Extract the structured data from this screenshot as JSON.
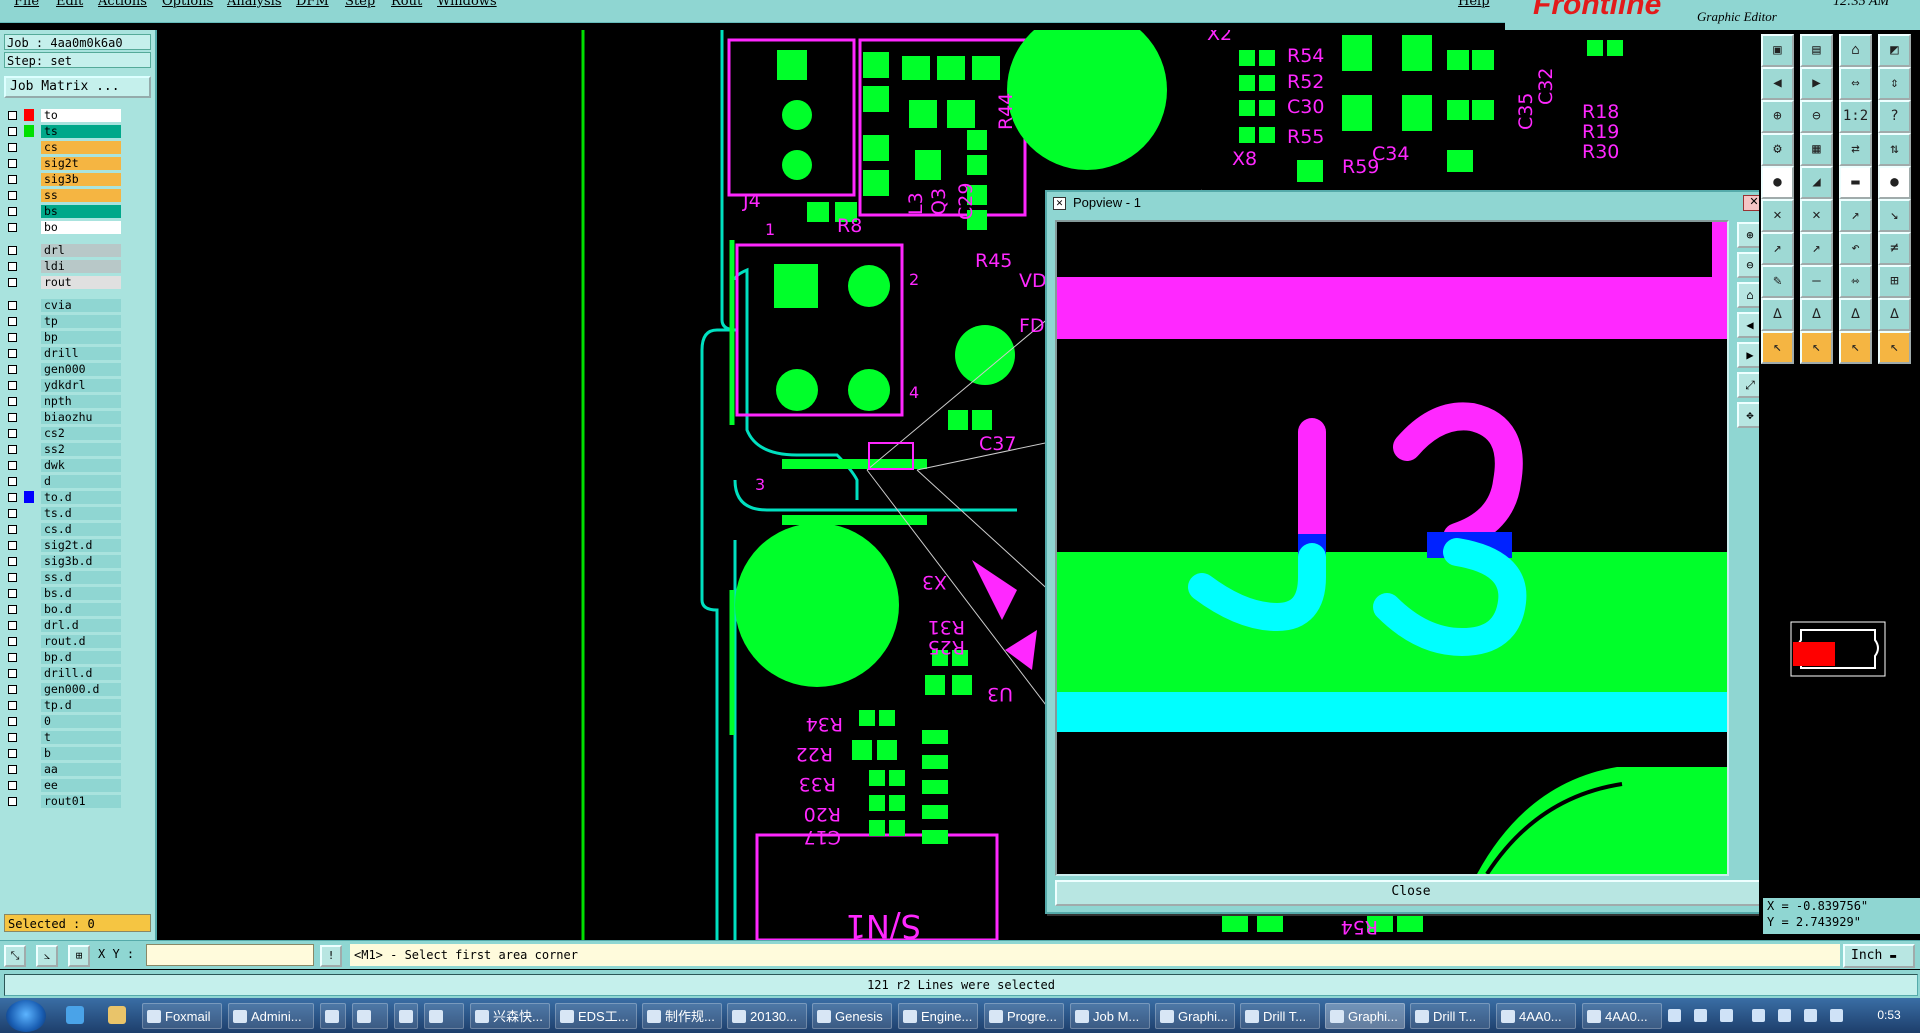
{
  "menu": [
    "File",
    "Edit",
    "Actions",
    "Options",
    "Analysis",
    "DFM",
    "Step",
    "Rout",
    "Windows"
  ],
  "help": "Help",
  "brand": {
    "logo": "Frontline",
    "subtitle": "Graphic Editor",
    "clock": "12:35 AM"
  },
  "job": {
    "job_label": "Job : 4aa0m0k6a0",
    "step_label": "Step: set",
    "matrix_button": "Job Matrix ..."
  },
  "layers": [
    {
      "name": "to",
      "swatch": "#ff0000",
      "bg": "#ffffff"
    },
    {
      "name": "ts",
      "swatch": "#00e000",
      "bg": "#00a88a"
    },
    {
      "name": "cs",
      "swatch": "",
      "bg": "#f5b542"
    },
    {
      "name": "sig2t",
      "swatch": "",
      "bg": "#f5b542"
    },
    {
      "name": "sig3b",
      "swatch": "",
      "bg": "#f5b542"
    },
    {
      "name": "ss",
      "swatch": "",
      "bg": "#f5b542"
    },
    {
      "name": "bs",
      "swatch": "",
      "bg": "#00a88a"
    },
    {
      "name": "bo",
      "swatch": "",
      "bg": "#ffffff"
    },
    {
      "name": "drl",
      "swatch": "",
      "bg": "#b8c8c8"
    },
    {
      "name": "ldi",
      "swatch": "",
      "bg": "#b8c8c8"
    },
    {
      "name": "rout",
      "swatch": "",
      "bg": "#e0e0e0"
    },
    {
      "name": "cvia",
      "swatch": "",
      "bg": "#8fd6d2"
    },
    {
      "name": "tp",
      "swatch": "",
      "bg": "#8fd6d2"
    },
    {
      "name": "bp",
      "swatch": "",
      "bg": "#8fd6d2"
    },
    {
      "name": "drill",
      "swatch": "",
      "bg": "#8fd6d2"
    },
    {
      "name": "gen000",
      "swatch": "",
      "bg": "#8fd6d2"
    },
    {
      "name": "ydkdrl",
      "swatch": "",
      "bg": "#8fd6d2"
    },
    {
      "name": "npth",
      "swatch": "",
      "bg": "#8fd6d2"
    },
    {
      "name": "biaozhu",
      "swatch": "",
      "bg": "#8fd6d2"
    },
    {
      "name": "cs2",
      "swatch": "",
      "bg": "#8fd6d2"
    },
    {
      "name": "ss2",
      "swatch": "",
      "bg": "#8fd6d2"
    },
    {
      "name": "dwk",
      "swatch": "",
      "bg": "#8fd6d2"
    },
    {
      "name": "d",
      "swatch": "",
      "bg": "#8fd6d2"
    },
    {
      "name": "to.d",
      "swatch": "#0000ff",
      "bg": "#8fd6d2"
    },
    {
      "name": "ts.d",
      "swatch": "",
      "bg": "#8fd6d2"
    },
    {
      "name": "cs.d",
      "swatch": "",
      "bg": "#8fd6d2"
    },
    {
      "name": "sig2t.d",
      "swatch": "",
      "bg": "#8fd6d2"
    },
    {
      "name": "sig3b.d",
      "swatch": "",
      "bg": "#8fd6d2"
    },
    {
      "name": "ss.d",
      "swatch": "",
      "bg": "#8fd6d2"
    },
    {
      "name": "bs.d",
      "swatch": "",
      "bg": "#8fd6d2"
    },
    {
      "name": "bo.d",
      "swatch": "",
      "bg": "#8fd6d2"
    },
    {
      "name": "drl.d",
      "swatch": "",
      "bg": "#8fd6d2"
    },
    {
      "name": "rout.d",
      "swatch": "",
      "bg": "#8fd6d2"
    },
    {
      "name": "bp.d",
      "swatch": "",
      "bg": "#8fd6d2"
    },
    {
      "name": "drill.d",
      "swatch": "",
      "bg": "#8fd6d2"
    },
    {
      "name": "gen000.d",
      "swatch": "",
      "bg": "#8fd6d2"
    },
    {
      "name": "tp.d",
      "swatch": "",
      "bg": "#8fd6d2"
    },
    {
      "name": "0",
      "swatch": "",
      "bg": "#8fd6d2"
    },
    {
      "name": "t",
      "swatch": "",
      "bg": "#8fd6d2"
    },
    {
      "name": "b",
      "swatch": "",
      "bg": "#8fd6d2"
    },
    {
      "name": "aa",
      "swatch": "",
      "bg": "#8fd6d2"
    },
    {
      "name": "ee",
      "swatch": "",
      "bg": "#8fd6d2"
    },
    {
      "name": "rout01",
      "swatch": "",
      "bg": "#8fd6d2"
    }
  ],
  "selected_label": "Selected : 0",
  "canvas_labels": [
    "X2",
    "R54",
    "R52",
    "C30",
    "R55",
    "C35",
    "C32",
    "R18",
    "R19",
    "R30",
    "C34",
    "X8",
    "R59",
    "J4",
    "R8",
    "L3",
    "Q3",
    "C29",
    "R44",
    "R45",
    "VD",
    "FD",
    "C37",
    "X3",
    "R31",
    "R25",
    "U3",
    "R34",
    "R22",
    "R33",
    "R20",
    "C17",
    "S/N1",
    "R54"
  ],
  "popview": {
    "title": "Popview - 1",
    "close": "✕",
    "close_button": "Close",
    "zoom_text": "J3"
  },
  "coords": {
    "x": "X = -0.839756\"",
    "y": "Y = 2.743929\""
  },
  "cmd": {
    "xy_label": "X Y :",
    "xy_value": "",
    "prompt": "<M1> - Select first area corner",
    "units": "Inch"
  },
  "status": "121 r2 Lines were selected",
  "taskbar": [
    "Foxmail",
    "Admini...",
    "",
    "",
    "",
    "",
    "兴森快...",
    "EDS工...",
    "制作规...",
    "20130...",
    "Genesis",
    "Engine...",
    "Progre...",
    "Job M...",
    "Graphi...",
    "Drill T...",
    "Graphi...",
    "Drill T...",
    "4AA0...",
    "4AA0..."
  ],
  "clock": "0:53",
  "colors": {
    "pad": "#00ff2a",
    "silk": "#ff28ff",
    "outline": "#00e0c0",
    "highlight": "#00ffff",
    "select": "#0022ff"
  }
}
